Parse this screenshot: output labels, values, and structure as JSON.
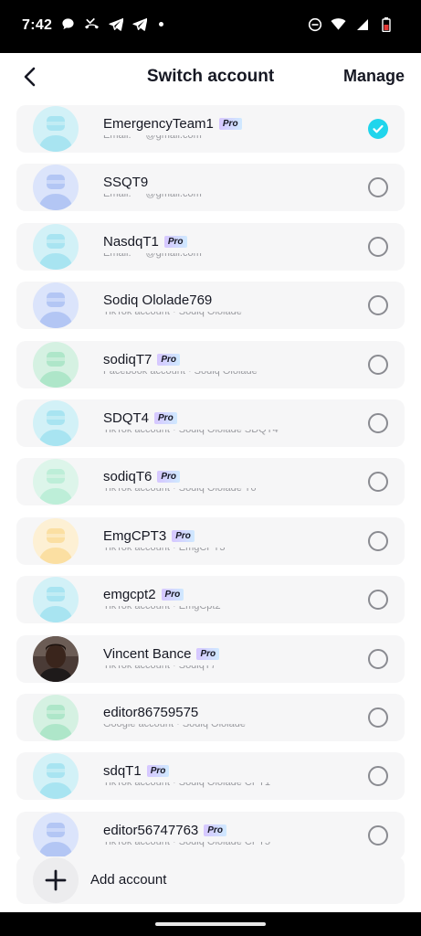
{
  "status_bar": {
    "time": "7:42",
    "left_icons": [
      "chat-bubble-icon",
      "missed-call-icon",
      "telegram-icon",
      "telegram-icon",
      "dot-icon"
    ],
    "right_icons": [
      "do-not-disturb-icon",
      "wifi-icon",
      "signal-icon",
      "battery-icon"
    ]
  },
  "header": {
    "title": "Switch account",
    "manage_label": "Manage"
  },
  "colors": {
    "accent": "#20d5ec",
    "card_bg": "#f6f6f7",
    "text": "#161823"
  },
  "pro_label": "Pro",
  "accounts": [
    {
      "name": "EmergencyTeam1",
      "pro": true,
      "sub": "Email: ***@gmail.com",
      "avatar": "teal",
      "selected": true
    },
    {
      "name": "SSQT9",
      "pro": false,
      "sub": "Email: ***@gmail.com",
      "avatar": "blue",
      "selected": false
    },
    {
      "name": "NasdqT1",
      "pro": true,
      "sub": "Email: ***@gmail.com",
      "avatar": "teal",
      "selected": false
    },
    {
      "name": "Sodiq Ololade769",
      "pro": false,
      "sub": "TikTok account · Sodiq Ololade",
      "avatar": "blue",
      "selected": false
    },
    {
      "name": "sodiqT7",
      "pro": true,
      "sub": "Facebook account · Sodiq Ololade",
      "avatar": "green",
      "selected": false
    },
    {
      "name": "SDQT4",
      "pro": true,
      "sub": "TikTok account · Sodiq Ololade SDQT4",
      "avatar": "teal",
      "selected": false
    },
    {
      "name": "sodiqT6",
      "pro": true,
      "sub": "TikTok account · Sodiq Ololade T6",
      "avatar": "mint",
      "selected": false
    },
    {
      "name": "EmgCPT3",
      "pro": true,
      "sub": "TikTok account · EmgCPT3",
      "avatar": "yellow",
      "selected": false
    },
    {
      "name": "emgcpt2",
      "pro": true,
      "sub": "TikTok account · EmgCpt2",
      "avatar": "teal",
      "selected": false
    },
    {
      "name": "Vincent Bance",
      "pro": true,
      "sub": "TikTok account · SodiqT7",
      "avatar": "photo",
      "selected": false
    },
    {
      "name": "editor86759575",
      "pro": false,
      "sub": "Google account · Sodiq Ololade",
      "avatar": "green",
      "selected": false
    },
    {
      "name": "sdqT1",
      "pro": true,
      "sub": "TikTok account · Sodiq Ololade CPT1",
      "avatar": "teal",
      "selected": false
    },
    {
      "name": "editor56747763",
      "pro": true,
      "sub": "TikTok account · Sodiq Ololade CPT5",
      "avatar": "blue",
      "selected": false
    }
  ],
  "add_account": {
    "label": "Add account",
    "icon": "plus-icon"
  }
}
